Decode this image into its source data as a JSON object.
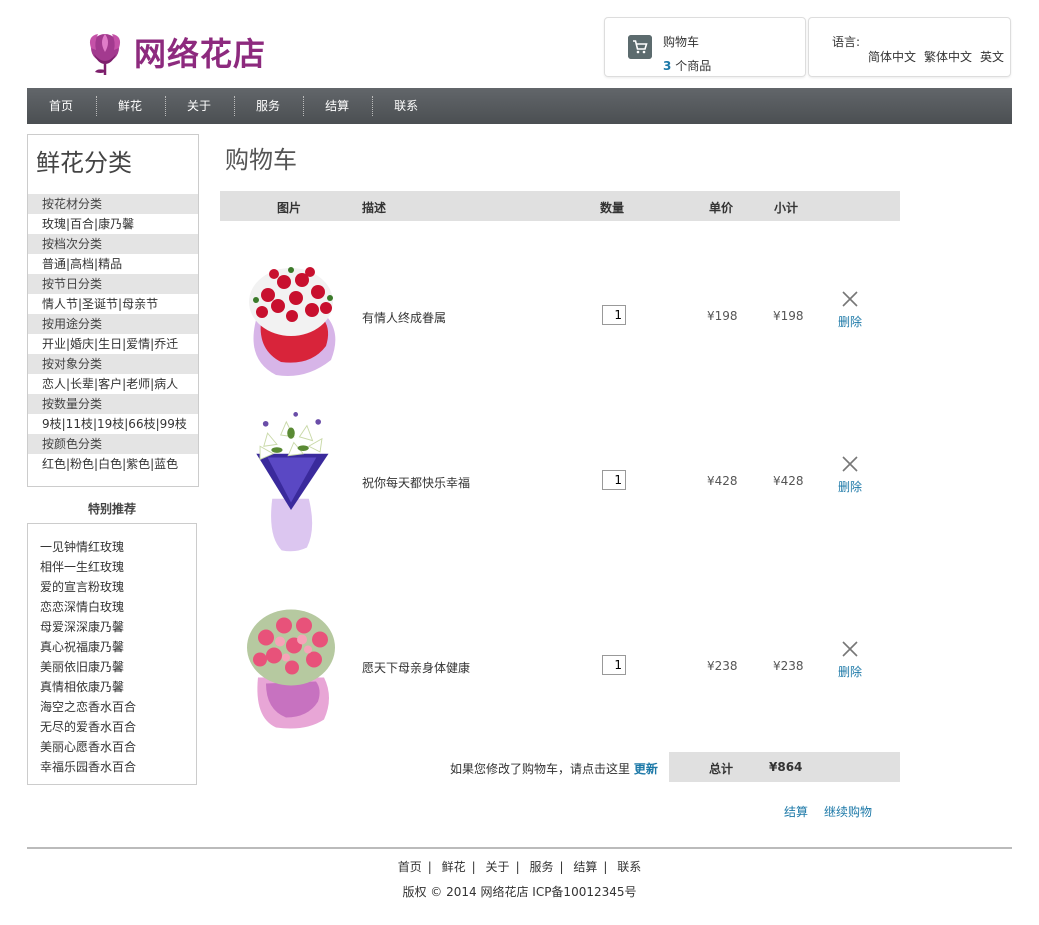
{
  "brand": {
    "name": "网络花店",
    "color": "#8d2a7e"
  },
  "cart": {
    "title": "购物车",
    "count": "3",
    "count_suffix": "个商品"
  },
  "language": {
    "label": "语言:",
    "options": [
      "简体中文",
      "繁体中文",
      "英文"
    ]
  },
  "nav": [
    "首页",
    "鲜花",
    "关于",
    "服务",
    "结算",
    "联系"
  ],
  "categories": {
    "title": "鲜花分类",
    "groups": [
      {
        "head": "按花材分类",
        "items": "玫瑰|百合|康乃馨"
      },
      {
        "head": "按档次分类",
        "items": "普通|高档|精品"
      },
      {
        "head": "按节日分类",
        "items": "情人节|圣诞节|母亲节"
      },
      {
        "head": "按用途分类",
        "items": "开业|婚庆|生日|爱情|乔迁"
      },
      {
        "head": "按对象分类",
        "items": "恋人|长辈|客户|老师|病人"
      },
      {
        "head": "按数量分类",
        "items": "9枝|11枝|19枝|66枝|99枝"
      },
      {
        "head": "按颜色分类",
        "items": "红色|粉色|白色|紫色|蓝色"
      }
    ]
  },
  "special": {
    "title": "特别推荐",
    "items": [
      "一见钟情红玫瑰",
      "相伴一生红玫瑰",
      "爱的宣言粉玫瑰",
      "恋恋深情白玫瑰",
      "母爱深深康乃馨",
      "真心祝福康乃馨",
      "美丽依旧康乃馨",
      "真情相依康乃馨",
      "海空之恋香水百合",
      "无尽的爱香水百合",
      "美丽心愿香水百合",
      "幸福乐园香水百合"
    ]
  },
  "main": {
    "title": "购物车",
    "columns": {
      "image": "图片",
      "desc": "描述",
      "qty": "数量",
      "price": "单价",
      "subtotal": "小计"
    },
    "rows": [
      {
        "desc": "有情人终成眷属",
        "qty": "1",
        "price": "¥198",
        "subtotal": "¥198",
        "delete": "删除"
      },
      {
        "desc": "祝你每天都快乐幸福",
        "qty": "1",
        "price": "¥428",
        "subtotal": "¥428",
        "delete": "删除"
      },
      {
        "desc": "愿天下母亲身体健康",
        "qty": "1",
        "price": "¥238",
        "subtotal": "¥238",
        "delete": "删除"
      }
    ],
    "update_note": "如果您修改了购物车，请点击这里",
    "update_link": "更新",
    "total_label": "总计",
    "total_value": "¥864",
    "checkout": "结算",
    "continue": "继续购物"
  },
  "footer": {
    "nav": [
      "首页",
      "鲜花",
      "关于",
      "服务",
      "结算",
      "联系"
    ],
    "copyright": "版权 © 2014 网络花店 ICP备10012345号"
  },
  "colors": {
    "link": "#1d79a8",
    "nav_bg": "#55595c",
    "row_head": "#e0e0e0"
  }
}
